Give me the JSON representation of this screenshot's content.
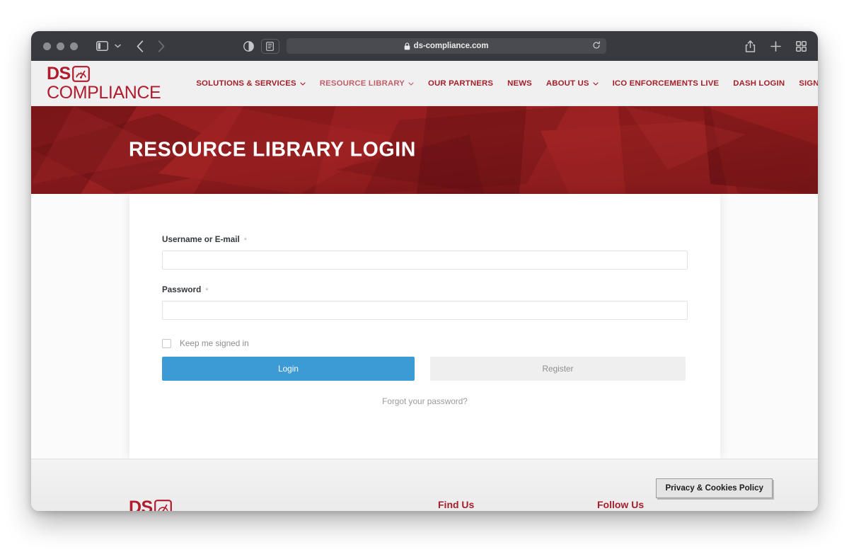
{
  "browser": {
    "url": "ds-compliance.com",
    "lock_icon": "lock-icon",
    "reload_icon": "reload-icon",
    "sidebar_icon": "sidebar-toggle-icon",
    "sidebar_chevron_icon": "chevron-down-icon",
    "back_icon": "chevron-left-icon",
    "forward_icon": "chevron-right-icon",
    "reader_icon": "reader-mode-icon",
    "privacy_report_icon": "privacy-report-icon",
    "share_icon": "share-icon",
    "new_tab_icon": "plus-icon",
    "tab_overview_icon": "tab-overview-icon",
    "traffic_lights": [
      "close",
      "minimize",
      "zoom"
    ]
  },
  "site": {
    "logo": {
      "line1": "DS",
      "line2": "COMPLIANCE",
      "gauge_icon": "gauge-icon"
    },
    "nav": [
      {
        "label": "SOLUTIONS & SERVICES",
        "has_caret": true,
        "active": false
      },
      {
        "label": "RESOURCE LIBRARY",
        "has_caret": true,
        "active": true
      },
      {
        "label": "OUR PARTNERS",
        "has_caret": false,
        "active": false
      },
      {
        "label": "NEWS",
        "has_caret": false,
        "active": false
      },
      {
        "label": "ABOUT US",
        "has_caret": true,
        "active": false
      },
      {
        "label": "ICO ENFORCEMENTS LIVE",
        "has_caret": false,
        "active": false
      },
      {
        "label": "DASH LOGIN",
        "has_caret": false,
        "active": false
      },
      {
        "label": "SIGN UP TODAY",
        "has_caret": false,
        "active": false
      }
    ],
    "hero": {
      "title": "RESOURCE LIBRARY LOGIN",
      "bg_color": "#7d1418",
      "bg_color_light": "#96201f"
    },
    "accent_red": "#a41f2a",
    "accent_blue": "#3c9ad4"
  },
  "login": {
    "username": {
      "label": "Username or E-mail",
      "required_mark": "*",
      "value": "",
      "placeholder": ""
    },
    "password": {
      "label": "Password",
      "required_mark": "*",
      "value": "",
      "placeholder": ""
    },
    "remember": {
      "label": "Keep me signed in",
      "checked": false
    },
    "login_button": "Login",
    "register_button": "Register",
    "forgot_link": "Forgot your password?"
  },
  "footer": {
    "logo_line1": "DS",
    "find_us": "Find Us",
    "follow_us": "Follow Us"
  },
  "privacy_widget": {
    "label": "Privacy & Cookies Policy"
  }
}
